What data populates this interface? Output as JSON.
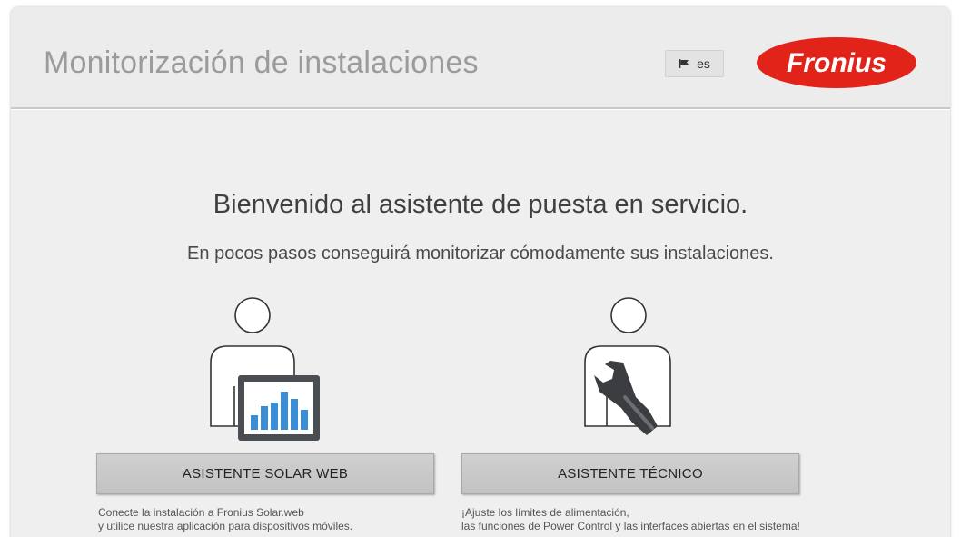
{
  "header": {
    "title": "Monitorización de instalaciones",
    "language_label": "es",
    "logo_text": "Fronius",
    "logo_color": "#e2231a"
  },
  "main": {
    "welcome_title": "Bienvenido al asistente de puesta en servicio.",
    "welcome_subtitle": "En pocos pasos conseguirá monitorizar cómodamente sus instalaciones.",
    "wizards": [
      {
        "button_label": "ASISTENTE SOLAR WEB",
        "icon": "user-with-chart-tablet-icon",
        "description_lines": [
          "Conecte la instalación a Fronius Solar.web",
          "y utilice nuestra aplicación para dispositivos móviles."
        ]
      },
      {
        "button_label": "ASISTENTE TÉCNICO",
        "icon": "user-with-wrench-icon",
        "description_lines": [
          "¡Ajuste los límites de alimentación,",
          "las funciones de Power Control y las interfaces abiertas en el sistema!"
        ]
      }
    ]
  },
  "colors": {
    "chart_bars": "#3a8ed6",
    "tablet_frame": "#4a4d52"
  }
}
